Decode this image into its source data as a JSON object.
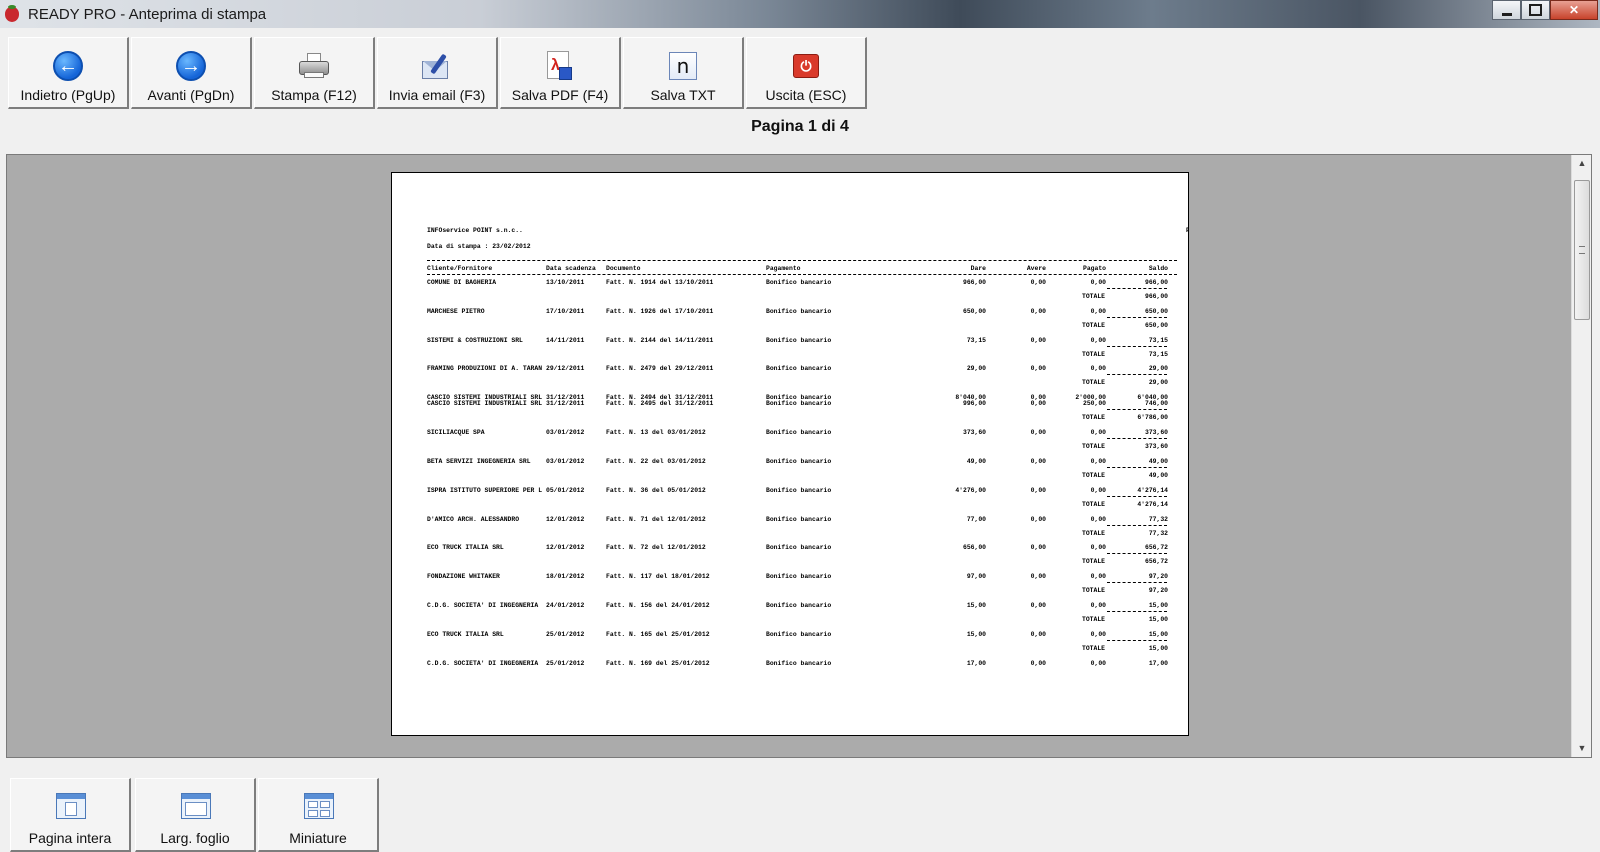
{
  "window": {
    "title": "READY PRO - Anteprima di stampa",
    "controls": {
      "minimize": "minimize-icon",
      "maximize": "maximize-icon",
      "close": "✕"
    }
  },
  "toolbar": {
    "buttons": [
      {
        "label": "Indietro (PgUp)",
        "icon": "arrow-left-icon"
      },
      {
        "label": "Avanti (PgDn)",
        "icon": "arrow-right-icon"
      },
      {
        "label": "Stampa (F12)",
        "icon": "printer-icon"
      },
      {
        "label": "Invia email (F3)",
        "icon": "email-icon"
      },
      {
        "label": "Salva PDF (F4)",
        "icon": "pdf-icon"
      },
      {
        "label": "Salva TXT",
        "icon": "txt-icon",
        "glyph": "n"
      },
      {
        "label": "Uscita (ESC)",
        "icon": "power-icon"
      }
    ]
  },
  "page_indicator": "Pagina 1 di 4",
  "report": {
    "company": "INFOservice POINT s.n.c..",
    "print_date": "Data di stampa : 23/02/2012",
    "corner_text": "P",
    "headers": {
      "cliente": "Cliente/Fornitore",
      "scadenza": "Data scadenza",
      "documento": "Documento",
      "pagamento": "Pagamento",
      "dare": "Dare",
      "avere": "Avere",
      "pagato": "Pagato",
      "saldo": "Saldo"
    },
    "groups": [
      {
        "rows": [
          {
            "cliente": "COMUNE DI  BAGHERIA",
            "scadenza": "13/10/2011",
            "documento": "Fatt. N. 1914 del 13/10/2011",
            "pagamento": "Bonifico bancario",
            "dare": "966,00",
            "avere": "0,00",
            "pagato": "0,00",
            "saldo": "966,00"
          }
        ],
        "totale_label": "TOTALE",
        "totale": "966,00"
      },
      {
        "rows": [
          {
            "cliente": "MARCHESE PIETRO",
            "scadenza": "17/10/2011",
            "documento": "Fatt. N. 1926 del 17/10/2011",
            "pagamento": "Bonifico bancario",
            "dare": "650,00",
            "avere": "0,00",
            "pagato": "0,00",
            "saldo": "650,00"
          }
        ],
        "totale_label": "TOTALE",
        "totale": "650,00"
      },
      {
        "rows": [
          {
            "cliente": "SISTEMI & COSTRUZIONI SRL",
            "scadenza": "14/11/2011",
            "documento": "Fatt. N. 2144 del 14/11/2011",
            "pagamento": "Bonifico bancario",
            "dare": "73,15",
            "avere": "0,00",
            "pagato": "0,00",
            "saldo": "73,15"
          }
        ],
        "totale_label": "TOTALE",
        "totale": "73,15"
      },
      {
        "rows": [
          {
            "cliente": "FRAMING PRODUZIONI DI A. TARAN",
            "scadenza": "29/12/2011",
            "documento": "Fatt. N. 2479 del 29/12/2011",
            "pagamento": "Bonifico bancario",
            "dare": "29,00",
            "avere": "0,00",
            "pagato": "0,00",
            "saldo": "29,00"
          }
        ],
        "totale_label": "TOTALE",
        "totale": "29,00"
      },
      {
        "rows": [
          {
            "cliente": "CASCIO SISTEMI INDUSTRIALI SRL",
            "scadenza": "31/12/2011",
            "documento": "Fatt. N. 2494 del 31/12/2011",
            "pagamento": "Bonifico bancario",
            "dare": "8'040,00",
            "avere": "0,00",
            "pagato": "2'000,00",
            "saldo": "6'040,00"
          },
          {
            "cliente": "CASCIO SISTEMI INDUSTRIALI SRL",
            "scadenza": "31/12/2011",
            "documento": "Fatt. N. 2495 del 31/12/2011",
            "pagamento": "Bonifico bancario",
            "dare": "996,00",
            "avere": "0,00",
            "pagato": "250,00",
            "saldo": "746,00"
          }
        ],
        "totale_label": "TOTALE",
        "totale": "6'786,00"
      },
      {
        "rows": [
          {
            "cliente": "SICILIACQUE SPA",
            "scadenza": "03/01/2012",
            "documento": "Fatt. N. 13 del 03/01/2012",
            "pagamento": "Bonifico bancario",
            "dare": "373,60",
            "avere": "0,00",
            "pagato": "0,00",
            "saldo": "373,60"
          }
        ],
        "totale_label": "TOTALE",
        "totale": "373,60"
      },
      {
        "rows": [
          {
            "cliente": "BETA SERVIZI INGEGNERIA SRL",
            "scadenza": "03/01/2012",
            "documento": "Fatt. N. 22 del 03/01/2012",
            "pagamento": "Bonifico bancario",
            "dare": "49,00",
            "avere": "0,00",
            "pagato": "0,00",
            "saldo": "49,00"
          }
        ],
        "totale_label": "TOTALE",
        "totale": "49,00"
      },
      {
        "rows": [
          {
            "cliente": "ISPRA ISTITUTO SUPERIORE PER L",
            "scadenza": "05/01/2012",
            "documento": "Fatt. N. 36 del 05/01/2012",
            "pagamento": "Bonifico bancario",
            "dare": "4'276,00",
            "avere": "0,00",
            "pagato": "0,00",
            "saldo": "4'276,14"
          }
        ],
        "totale_label": "TOTALE",
        "totale": "4'276,14"
      },
      {
        "rows": [
          {
            "cliente": "D'AMICO ARCH. ALESSANDRO",
            "scadenza": "12/01/2012",
            "documento": "Fatt. N. 71 del 12/01/2012",
            "pagamento": "Bonifico bancario",
            "dare": "77,00",
            "avere": "0,00",
            "pagato": "0,00",
            "saldo": "77,32"
          }
        ],
        "totale_label": "TOTALE",
        "totale": "77,32"
      },
      {
        "rows": [
          {
            "cliente": "ECO TRUCK ITALIA SRL",
            "scadenza": "12/01/2012",
            "documento": "Fatt. N. 72 del 12/01/2012",
            "pagamento": "Bonifico bancario",
            "dare": "656,00",
            "avere": "0,00",
            "pagato": "0,00",
            "saldo": "656,72"
          }
        ],
        "totale_label": "TOTALE",
        "totale": "656,72"
      },
      {
        "rows": [
          {
            "cliente": "FONDAZIONE WHITAKER",
            "scadenza": "18/01/2012",
            "documento": "Fatt. N. 117 del 18/01/2012",
            "pagamento": "Bonifico bancario",
            "dare": "97,00",
            "avere": "0,00",
            "pagato": "0,00",
            "saldo": "97,20"
          }
        ],
        "totale_label": "TOTALE",
        "totale": "97,20"
      },
      {
        "rows": [
          {
            "cliente": "C.D.G. SOCIETA' DI INGEGNERIA",
            "scadenza": "24/01/2012",
            "documento": "Fatt. N. 156 del 24/01/2012",
            "pagamento": "Bonifico bancario",
            "dare": "15,00",
            "avere": "0,00",
            "pagato": "0,00",
            "saldo": "15,00"
          }
        ],
        "totale_label": "TOTALE",
        "totale": "15,00"
      },
      {
        "rows": [
          {
            "cliente": "ECO TRUCK ITALIA SRL",
            "scadenza": "25/01/2012",
            "documento": "Fatt. N. 165 del 25/01/2012",
            "pagamento": "Bonifico bancario",
            "dare": "15,00",
            "avere": "0,00",
            "pagato": "0,00",
            "saldo": "15,00"
          }
        ],
        "totale_label": "TOTALE",
        "totale": "15,00"
      },
      {
        "rows": [
          {
            "cliente": "C.D.G. SOCIETA' DI INGEGNERIA",
            "scadenza": "25/01/2012",
            "documento": "Fatt. N. 169 del 25/01/2012",
            "pagamento": "Bonifico bancario",
            "dare": "17,00",
            "avere": "0,00",
            "pagato": "0,00",
            "saldo": "17,00"
          }
        ]
      }
    ]
  },
  "view_buttons": [
    {
      "label": "Pagina intera",
      "icon": "full-page-icon"
    },
    {
      "label": "Larg. foglio",
      "icon": "page-width-icon"
    },
    {
      "label": "Miniature",
      "icon": "thumbnails-icon"
    }
  ],
  "colors": {
    "preview_bg": "#ababab",
    "button_face": "#f4f4f4",
    "arrow_blue": "#1565d8",
    "exit_red": "#d93a2b"
  }
}
